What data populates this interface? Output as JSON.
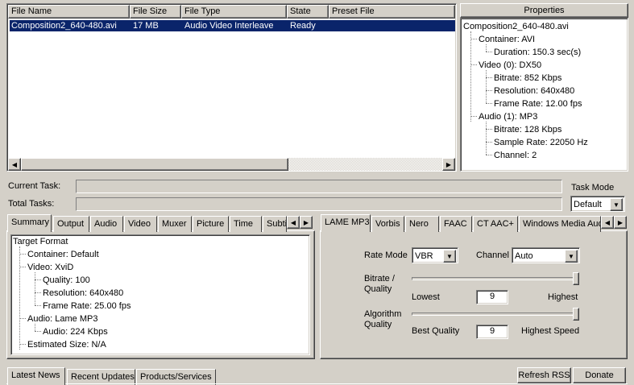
{
  "file_list": {
    "columns": [
      "File Name",
      "File Size",
      "File Type",
      "State",
      "Preset File"
    ],
    "rows": [
      {
        "name": "Composition2_640-480.avi",
        "size": "17 MB",
        "type": "Audio Video Interleave",
        "state": "Ready",
        "preset": ""
      }
    ]
  },
  "properties": {
    "title": "Properties",
    "items": [
      "Composition2_640-480.avi",
      "Container: AVI",
      "Duration: 150.3 sec(s)",
      "Video (0): DX50",
      "Bitrate: 852 Kbps",
      "Resolution: 640x480",
      "Frame Rate: 12.00 fps",
      "Audio (1): MP3",
      "Bitrate: 128 Kbps",
      "Sample Rate: 22050 Hz",
      "Channel: 2"
    ]
  },
  "tasks": {
    "current_label": "Current Task:",
    "total_label": "Total Tasks:",
    "mode_label": "Task Mode",
    "mode_value": "Default"
  },
  "left_tabs": [
    "Summary",
    "Output",
    "Audio",
    "Video",
    "Muxer",
    "Picture",
    "Time",
    "Subti"
  ],
  "summary_tree": [
    "Target Format",
    "Container: Default",
    "Video: XviD",
    "Quality: 100",
    "Resolution: 640x480",
    "Frame Rate: 25.00 fps",
    "Audio: Lame MP3",
    "Audio: 224 Kbps",
    "Estimated Size: N/A"
  ],
  "right_tabs": [
    "LAME MP3",
    "Vorbis",
    "Nero",
    "FAAC",
    "CT AAC+",
    "Windows Media Aud"
  ],
  "lame": {
    "rate_mode_label": "Rate Mode",
    "rate_mode_value": "VBR",
    "channel_label": "Channel",
    "channel_value": "Auto",
    "bitrate_label_1": "Bitrate /",
    "bitrate_label_2": "Quality",
    "bitrate_low": "Lowest",
    "bitrate_high": "Highest",
    "bitrate_value": "9",
    "algo_label_1": "Algorithm",
    "algo_label_2": "Quality",
    "algo_low": "Best Quality",
    "algo_high": "Highest Speed",
    "algo_value": "9"
  },
  "bottom_tabs": [
    "Latest News",
    "Recent Updates",
    "Products/Services"
  ],
  "buttons": {
    "refresh": "Refresh RSS",
    "donate": "Donate"
  }
}
